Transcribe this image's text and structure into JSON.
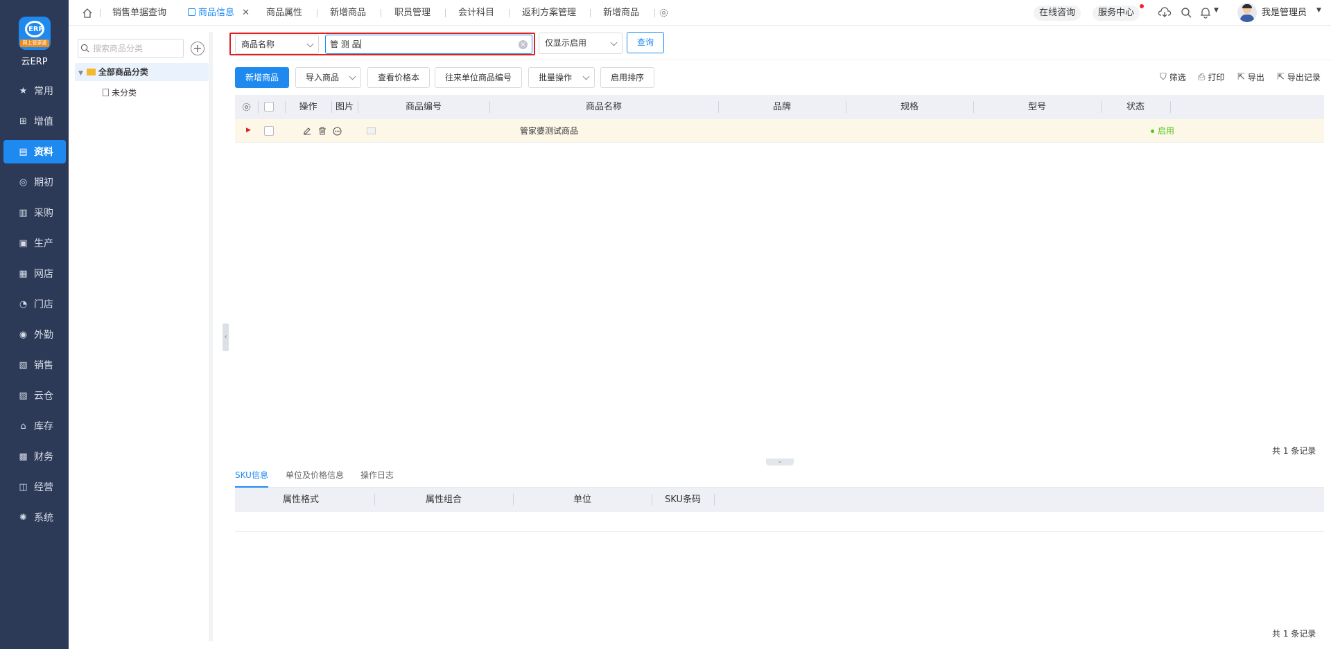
{
  "app": {
    "logo_text": "ERP",
    "logo_band": "网上管家婆",
    "name": "云ERP"
  },
  "nav": [
    {
      "label": "常用",
      "icon": "star-icon",
      "glyph": "★"
    },
    {
      "label": "增值",
      "icon": "plus-square-icon",
      "glyph": "⊞"
    },
    {
      "label": "资料",
      "icon": "document-icon",
      "glyph": "▤",
      "active": true
    },
    {
      "label": "期初",
      "icon": "target-icon",
      "glyph": "◎"
    },
    {
      "label": "采购",
      "icon": "receipt-icon",
      "glyph": "▥"
    },
    {
      "label": "生产",
      "icon": "factory-icon",
      "glyph": "▣"
    },
    {
      "label": "网店",
      "icon": "store-icon",
      "glyph": "▦"
    },
    {
      "label": "门店",
      "icon": "pie-icon",
      "glyph": "◔"
    },
    {
      "label": "外勤",
      "icon": "compass-icon",
      "glyph": "◉"
    },
    {
      "label": "销售",
      "icon": "bar-chart-icon",
      "glyph": "▧"
    },
    {
      "label": "云仓",
      "icon": "warehouse-icon",
      "glyph": "▨"
    },
    {
      "label": "库存",
      "icon": "home-icon",
      "glyph": "⌂"
    },
    {
      "label": "财务",
      "icon": "wallet-icon",
      "glyph": "▩"
    },
    {
      "label": "经营",
      "icon": "chart-line-icon",
      "glyph": "◫"
    },
    {
      "label": "系统",
      "icon": "gear-icon",
      "glyph": "✺"
    }
  ],
  "tabs": [
    {
      "label": "销售单据查询"
    },
    {
      "label": "商品信息",
      "active": true
    },
    {
      "label": "商品属性"
    },
    {
      "label": "新增商品"
    },
    {
      "label": "职员管理"
    },
    {
      "label": "会计科目"
    },
    {
      "label": "返利方案管理"
    },
    {
      "label": "新增商品"
    }
  ],
  "topright": {
    "consult": "在线咨询",
    "service": "服务中心",
    "user": "我是管理员"
  },
  "category": {
    "search_placeholder": "搜索商品分类",
    "root": "全部商品分类",
    "child": "未分类"
  },
  "filter": {
    "field": "商品名称",
    "search_value": "管 测 品",
    "status_filter": "仅显示启用",
    "query_label": "查询"
  },
  "toolbar": {
    "add": "新增商品",
    "import": "导入商品",
    "price_book": "查看价格本",
    "partner_code": "往来单位商品编号",
    "batch": "批量操作",
    "sort": "启用排序",
    "filter": "筛选",
    "print": "打印",
    "export": "导出",
    "export_log": "导出记录"
  },
  "table": {
    "headers": [
      "操作",
      "图片",
      "商品编号",
      "商品名称",
      "品牌",
      "规格",
      "型号",
      "状态"
    ],
    "rows": [
      {
        "code": "",
        "name": "管家婆测试商品",
        "brand": "",
        "spec": "",
        "model": "",
        "status": "启用"
      }
    ],
    "count": "共 1 条记录"
  },
  "bottom": {
    "tabs": [
      "SKU信息",
      "单位及价格信息",
      "操作日志"
    ],
    "headers": [
      "属性格式",
      "属性组合",
      "单位",
      "SKU条码"
    ],
    "count": "共 1 条记录"
  },
  "colors": {
    "nav_bg": "#2d3a57",
    "accent": "#1e8af0",
    "highlight": "#e02020",
    "status_green": "#52c41a",
    "row_highlight": "#fdf7e8"
  }
}
